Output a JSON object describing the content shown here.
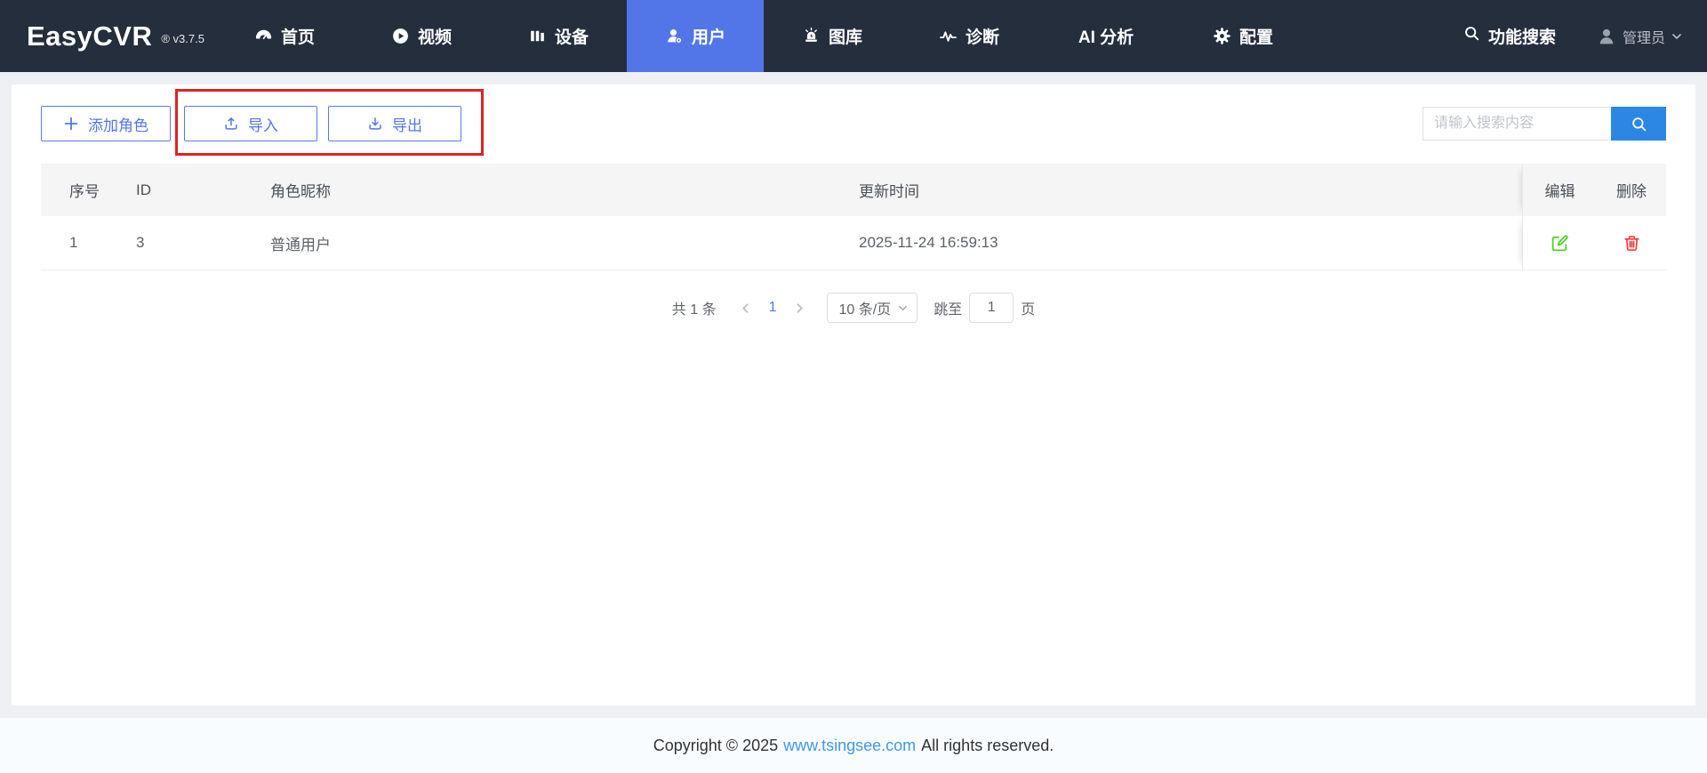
{
  "navbar": {
    "logo": "EasyCVR",
    "version": "® v3.7.5",
    "items": [
      {
        "label": "首页",
        "icon": "dashboard-icon",
        "active": false
      },
      {
        "label": "视频",
        "icon": "play-icon",
        "active": false
      },
      {
        "label": "设备",
        "icon": "device-icon",
        "active": false
      },
      {
        "label": "用户",
        "icon": "user-icon",
        "active": true
      },
      {
        "label": "图库",
        "icon": "alarm-icon",
        "active": false
      },
      {
        "label": "诊断",
        "icon": "pulse-icon",
        "active": false
      },
      {
        "label": "AI 分析",
        "icon": "none",
        "active": false
      },
      {
        "label": "配置",
        "icon": "gear-icon",
        "active": false
      }
    ],
    "function_search_label": "功能搜索",
    "user": {
      "name": "管理员"
    }
  },
  "toolbar": {
    "add_role_label": "添加角色",
    "import_label": "导入",
    "export_label": "导出",
    "search_placeholder": "请输入搜索内容"
  },
  "table": {
    "columns": [
      "序号",
      "ID",
      "角色昵称",
      "更新时间",
      "编辑",
      "删除"
    ],
    "rows": [
      {
        "index": "1",
        "id": "3",
        "name": "普通用户",
        "updated": "2025-11-24 16:59:13"
      }
    ]
  },
  "pagination": {
    "total_label": "共 1 条",
    "current_page": "1",
    "page_size_label": "10 条/页",
    "jump_prefix": "跳至",
    "jump_value": "1",
    "jump_suffix": "页"
  },
  "footer": {
    "copyright_prefix": "Copyright © 2025",
    "link": "www.tsingsee.com",
    "copyright_suffix": "All rights reserved."
  },
  "colors": {
    "nav_bg": "#252e3d",
    "nav_active_blue": "#5276e8",
    "primary_button_blue": "#5276e8",
    "search_button_blue": "#2b87e3",
    "annotation_red": "#e02222",
    "edit_green": "#4fd124",
    "delete_red": "#f43b3b",
    "link_blue": "#3e97f0"
  }
}
